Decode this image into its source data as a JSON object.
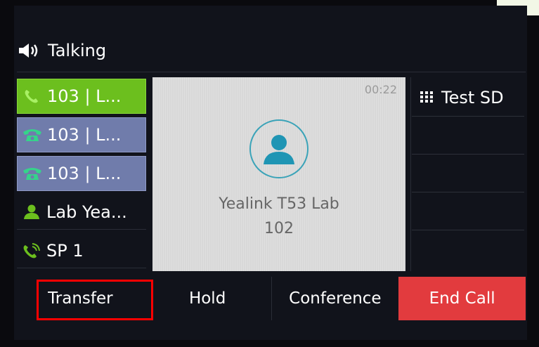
{
  "status": {
    "label": "Talking",
    "icon": "speaker-icon"
  },
  "lines": [
    {
      "label": "103 | L...",
      "state": "active",
      "icon": "phone-icon",
      "color": "#6cbf1e"
    },
    {
      "label": "103 | L...",
      "state": "held",
      "icon": "handset-icon",
      "color": "#707cab"
    },
    {
      "label": "103 | L...",
      "state": "held",
      "icon": "handset-icon",
      "color": "#707cab"
    },
    {
      "label": "Lab Yea...",
      "state": "idle",
      "icon": "user-icon",
      "color": "#6cbf1e"
    },
    {
      "label": "SP 1",
      "state": "idle",
      "icon": "speed-dial-phone-icon",
      "color": "#6cbf1e"
    }
  ],
  "call": {
    "timer": "00:22",
    "name": "Yealink T53 Lab",
    "number": "102",
    "avatar_icon": "contact-avatar-icon",
    "accent": "#3aa3b8"
  },
  "dss_keys": [
    {
      "label": "Test SD",
      "icon": "keypad-icon"
    },
    {
      "label": ""
    },
    {
      "label": ""
    },
    {
      "label": ""
    },
    {
      "label": ""
    }
  ],
  "softkeys": {
    "transfer": "Transfer",
    "hold": "Hold",
    "conference": "Conference",
    "end_call": "End Call",
    "end_call_color": "#e23b3e"
  },
  "annotation": {
    "highlight_color": "#ff0000",
    "target": "transfer"
  }
}
